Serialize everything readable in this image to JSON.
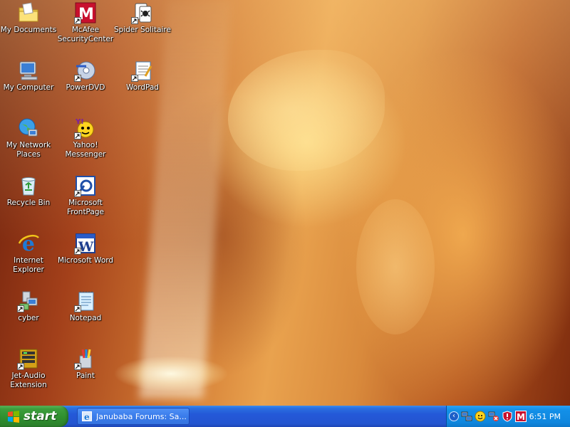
{
  "desktop": {
    "icons": [
      {
        "name": "my-documents",
        "label": "My Documents",
        "icon": "folder-documents-icon"
      },
      {
        "name": "my-computer",
        "label": "My Computer",
        "icon": "computer-icon"
      },
      {
        "name": "my-network-places",
        "label": "My Network\nPlaces",
        "icon": "network-globe-icon"
      },
      {
        "name": "recycle-bin",
        "label": "Recycle Bin",
        "icon": "recycle-bin-icon"
      },
      {
        "name": "internet-explorer",
        "label": "Internet\nExplorer",
        "icon": "internet-explorer-icon"
      },
      {
        "name": "cyber",
        "label": "cyber",
        "icon": "cyber-program-icon"
      },
      {
        "name": "jet-audio-extension",
        "label": "Jet-Audio\nExtension",
        "icon": "jet-audio-icon"
      },
      {
        "name": "mcafee-securitycenter",
        "label": "McAfee\nSecurityCenter",
        "icon": "mcafee-icon"
      },
      {
        "name": "powerdvd",
        "label": "PowerDVD",
        "icon": "powerdvd-icon"
      },
      {
        "name": "yahoo-messenger",
        "label": "Yahoo!\nMessenger",
        "icon": "yahoo-messenger-icon"
      },
      {
        "name": "microsoft-frontpage",
        "label": "Microsoft\nFrontPage",
        "icon": "frontpage-icon"
      },
      {
        "name": "microsoft-word",
        "label": "Microsoft Word",
        "icon": "word-icon"
      },
      {
        "name": "notepad",
        "label": "Notepad",
        "icon": "notepad-icon"
      },
      {
        "name": "paint",
        "label": "Paint",
        "icon": "paint-icon"
      },
      {
        "name": "spider-solitaire",
        "label": "Spider Solitaire",
        "icon": "spider-solitaire-icon"
      },
      {
        "name": "wordpad",
        "label": "WordPad",
        "icon": "wordpad-icon"
      }
    ]
  },
  "taskbar": {
    "start_label": "start",
    "window_title": "Janubaba Forums: Sa...",
    "clock": "6:51 PM",
    "tray_icons": [
      "show-hidden-chevron-icon",
      "network-connection-icon",
      "yahoo-messenger-tray-icon",
      "network-disconnected-icon",
      "security-alert-icon",
      "mcafee-tray-icon"
    ]
  },
  "colors": {
    "taskbar_blue": "#2458d8",
    "start_green": "#3c9e3c",
    "tray_blue": "#0f86dd",
    "mcafee_red": "#c8102e"
  }
}
